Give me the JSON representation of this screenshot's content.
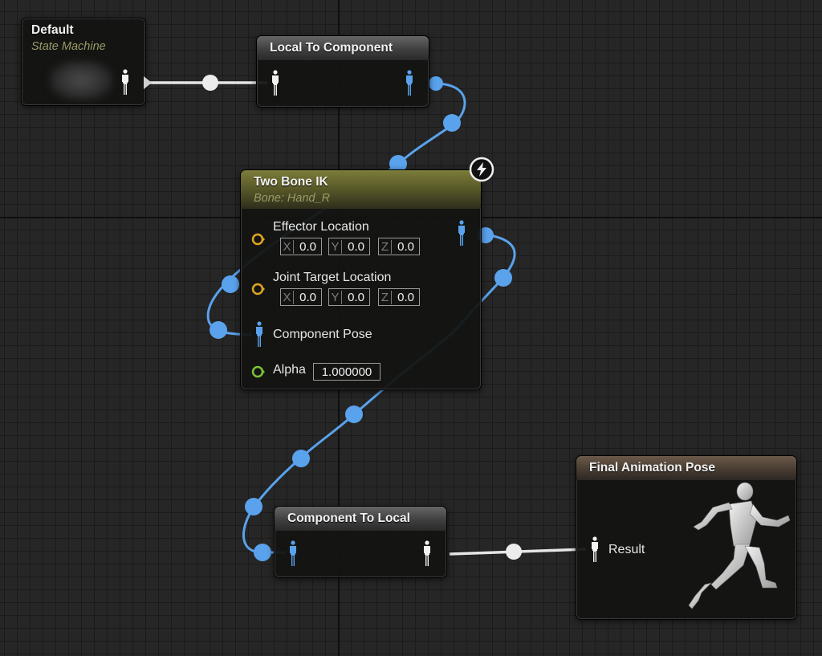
{
  "nodes": {
    "default": {
      "title": "Default",
      "subtitle": "State Machine"
    },
    "local_to_component": {
      "title": "Local To Component"
    },
    "two_bone_ik": {
      "title": "Two Bone IK",
      "subtitle": "Bone: Hand_R",
      "pins": {
        "effector_location": {
          "label": "Effector Location",
          "x_axis": "X",
          "x": "0.0",
          "y_axis": "Y",
          "y": "0.0",
          "z_axis": "Z",
          "z": "0.0"
        },
        "joint_target_location": {
          "label": "Joint Target Location",
          "x_axis": "X",
          "x": "0.0",
          "y_axis": "Y",
          "y": "0.0",
          "z_axis": "Z",
          "z": "0.0"
        },
        "component_pose": {
          "label": "Component Pose"
        },
        "alpha": {
          "label": "Alpha",
          "value": "1.000000"
        }
      }
    },
    "component_to_local": {
      "title": "Component To Local"
    },
    "final_animation_pose": {
      "title": "Final Animation Pose",
      "result_label": "Result"
    }
  },
  "colors": {
    "local_pose_wire": "#e8e8e8",
    "component_pose_wire": "#5aa2ec",
    "vector_pin": "#e0a520",
    "float_pin": "#7cc23a"
  },
  "icons": {
    "pose_pin": "person-pose-icon",
    "fast_path": "lightning-badge-icon",
    "vector_pin": "ring-pin-icon",
    "preview": "mannequin-runner-icon"
  }
}
